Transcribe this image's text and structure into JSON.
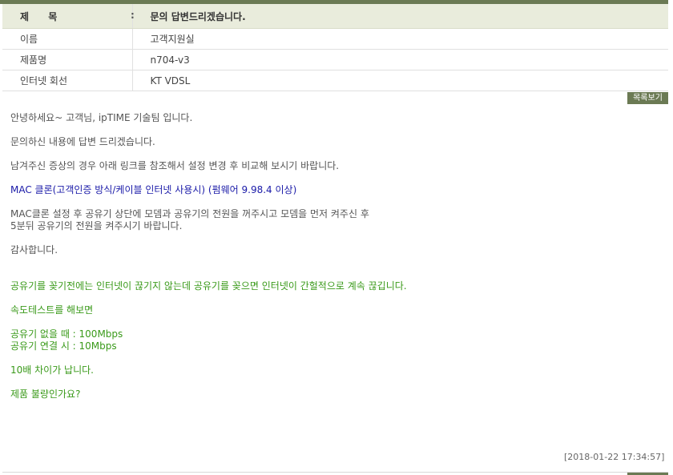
{
  "header": {
    "title_label": "제 목",
    "colon": ":",
    "title_value": "문의 답변드리겠습니다."
  },
  "info": [
    {
      "label": "이름",
      "value": "고객지원실"
    },
    {
      "label": "제품명",
      "value": "n704-v3"
    },
    {
      "label": "인터넷 회선",
      "value": "KT VDSL"
    }
  ],
  "list_button": "목록보기",
  "content": {
    "greeting": "안녕하세요~ 고객님, ipTIME 기술팀 입니다.",
    "answer_intro": "문의하신 내용에 답변 드리겠습니다.",
    "instruction": "남겨주신 증상의 경우 아래 링크를 참조해서 설정 변경 후 비교해 보시기 바랍니다.",
    "link": "MAC 클론(고객인증 방식/케이블 인터넷 사용시) (펌웨어 9.98.4 이상)",
    "mac_note": "MAC클론 설정 후 공유기 상단에 모뎀과 공유기의 전원을 꺼주시고 모뎀을 먼저 켜주신 후\n5분뒤 공유기의 전원을 켜주시기 바랍니다.",
    "thanks": "감사합니다.",
    "q1": "공유기를 꽂기전에는 인터넷이 끊기지 않는데 공유기를 꽂으면 인터넷이 간헐적으로 계속 끊깁니다.",
    "q2": "속도테스트를 해보면",
    "q3": "공유기 없을 때 : 100Mbps\n공유기 연결 시 : 10Mbps",
    "q4": "10배 차이가 납니다.",
    "q5": "제품 불량인가요?"
  },
  "timestamp": "[2018-01-22 17:34:57]",
  "colors": {
    "accent": "#6b7a54",
    "title_bg": "#e9ecdc",
    "link": "#1a1aa8",
    "question": "#3a9a1a"
  }
}
